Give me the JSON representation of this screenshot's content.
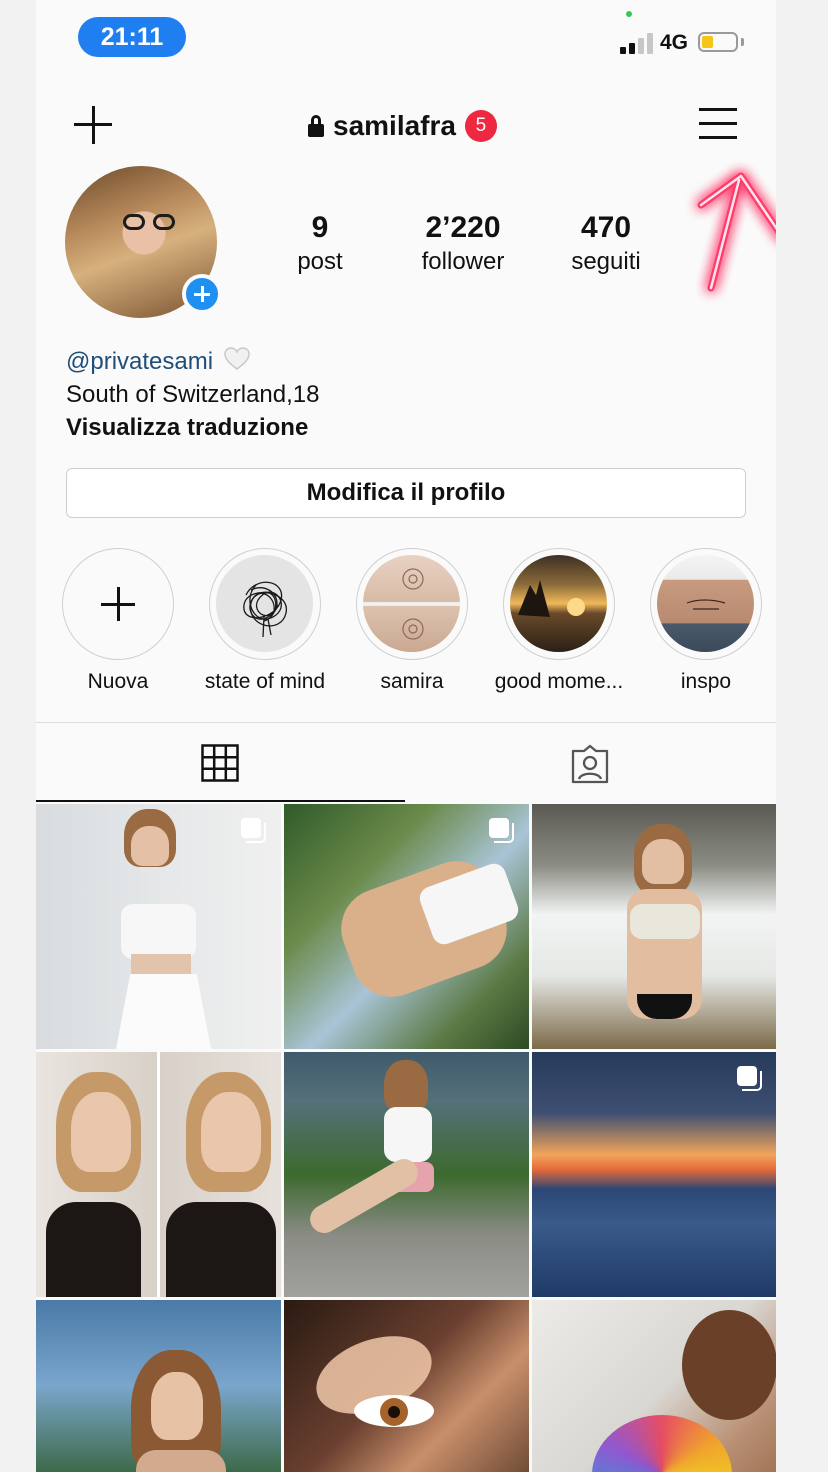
{
  "status_bar": {
    "time": "21:11",
    "network": "4G"
  },
  "header": {
    "username": "samilafra",
    "notification_count": "5"
  },
  "stats": [
    {
      "value": "9",
      "label": "post"
    },
    {
      "value": "2’220",
      "label": "follower"
    },
    {
      "value": "470",
      "label": "seguiti"
    }
  ],
  "bio": {
    "handle": "@privatesami",
    "line2": "South of Switzerland,18",
    "translate": "Visualizza traduzione"
  },
  "edit_profile_label": "Modifica il profilo",
  "highlights": [
    {
      "label": "Nuova"
    },
    {
      "label": "state of mind"
    },
    {
      "label": "samira"
    },
    {
      "label": "good mome..."
    },
    {
      "label": "inspo"
    }
  ],
  "posts": [
    {
      "multi": true
    },
    {
      "multi": true
    },
    {
      "multi": false
    },
    {
      "multi": false
    },
    {
      "multi": false
    },
    {
      "multi": true
    },
    {
      "multi": false
    },
    {
      "multi": false
    },
    {
      "multi": false
    }
  ],
  "colors": {
    "accent_blue": "#1f8ff2",
    "status_pill": "#1f7ff0",
    "badge_red": "#ed2840",
    "handle_link": "#1f4e79",
    "neon_pink": "#ff3a6a"
  },
  "icons": {
    "new_post": "plus-icon",
    "private": "lock-icon",
    "menu": "hamburger-menu-icon",
    "grid_tab": "grid-icon",
    "tagged_tab": "tagged-person-icon"
  }
}
